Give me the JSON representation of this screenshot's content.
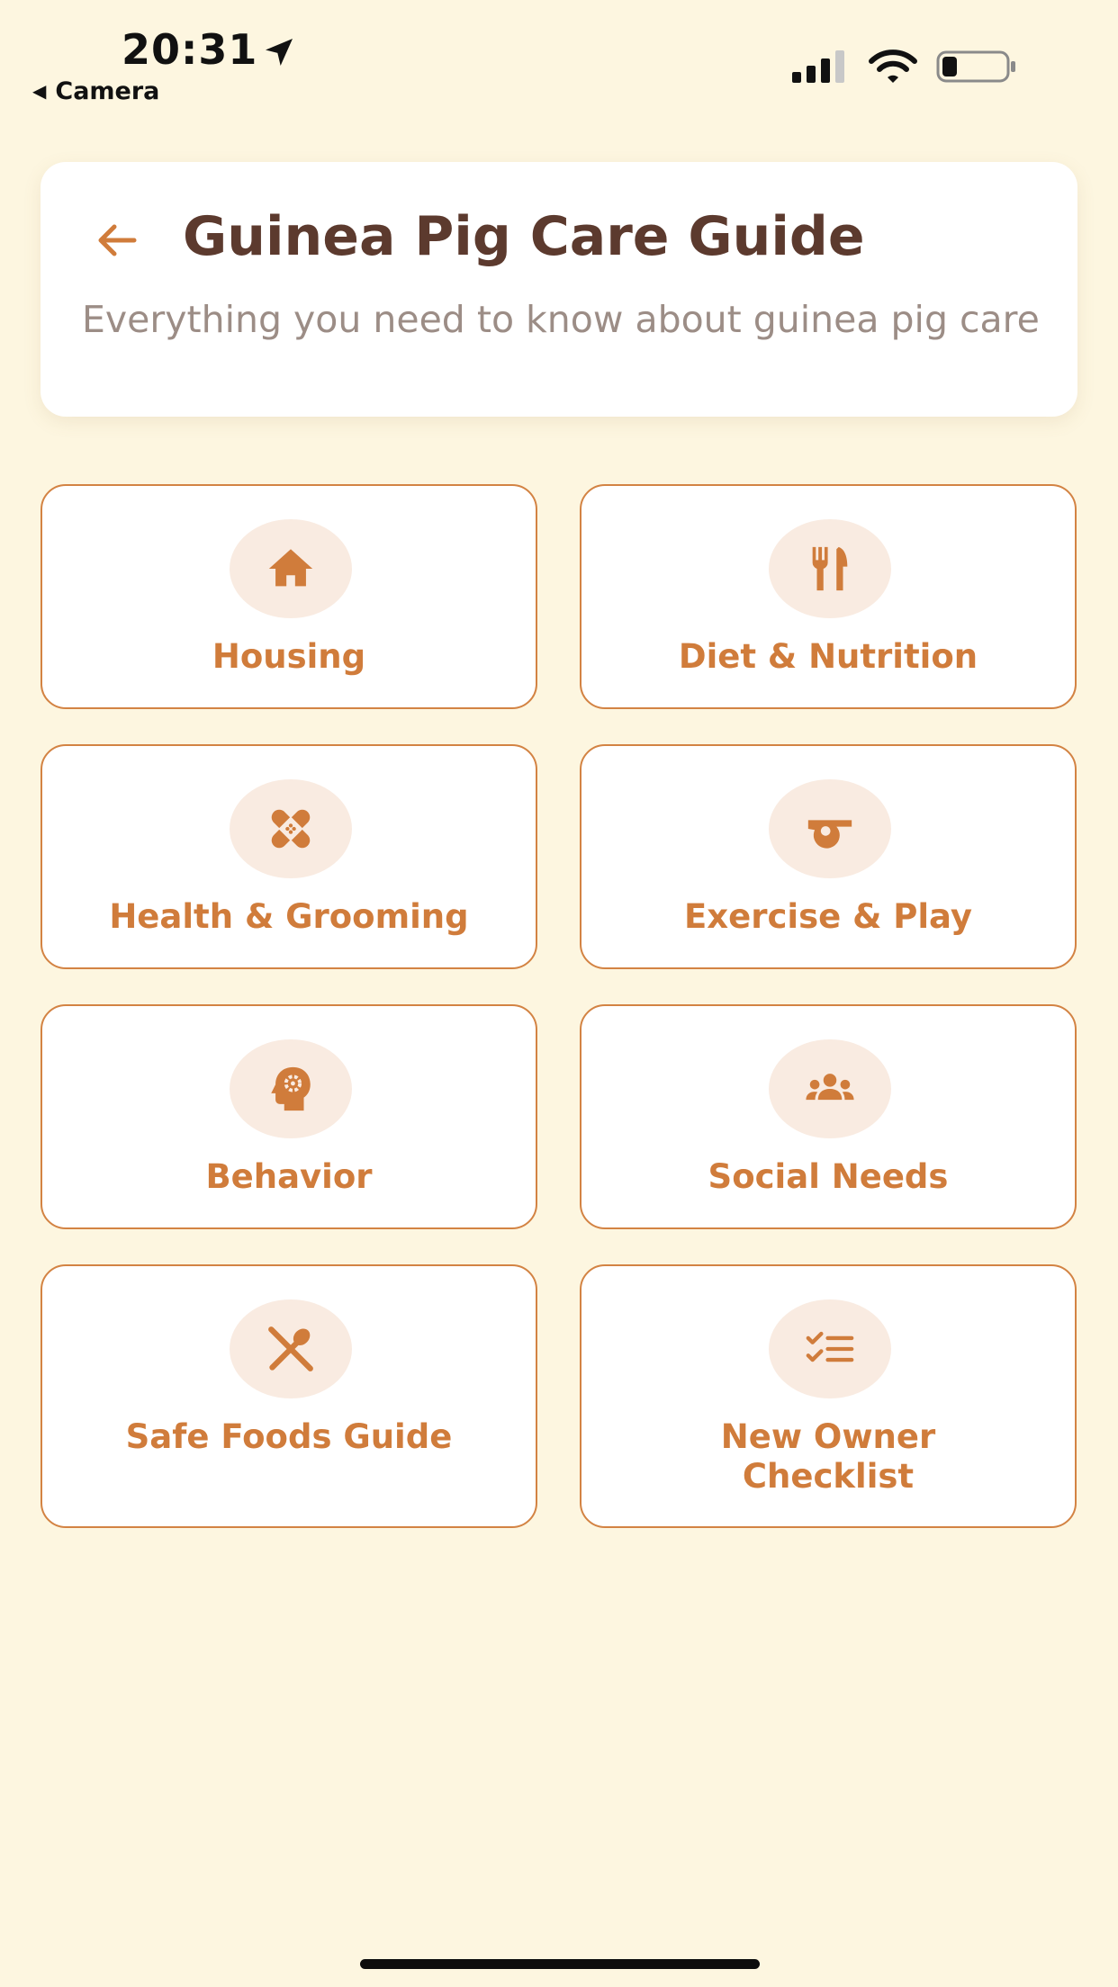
{
  "status_bar": {
    "time": "20:31",
    "back_app_label": "Camera",
    "icons": [
      "location-arrow-icon",
      "cellular-signal-icon",
      "wifi-icon",
      "battery-icon"
    ]
  },
  "header": {
    "title": "Guinea Pig Care Guide",
    "subtitle": "Everything you need to know about guinea pig care"
  },
  "categories": [
    {
      "label": "Housing",
      "icon": "house-icon"
    },
    {
      "label": "Diet & Nutrition",
      "icon": "fork-knife-icon"
    },
    {
      "label": "Health & Grooming",
      "icon": "bandage-icon"
    },
    {
      "label": "Exercise & Play",
      "icon": "whistle-icon"
    },
    {
      "label": "Behavior",
      "icon": "head-gear-icon"
    },
    {
      "label": "Social Needs",
      "icon": "people-group-icon"
    },
    {
      "label": "Safe Foods Guide",
      "icon": "utensils-crossed-icon"
    },
    {
      "label": "New Owner Checklist",
      "icon": "checklist-icon"
    }
  ],
  "colors": {
    "background": "#fdf6e0",
    "accent": "#d07c3b",
    "title": "#5c3a2e",
    "subtitle": "#9c8d86",
    "icon_circle": "#f9ebe1"
  }
}
